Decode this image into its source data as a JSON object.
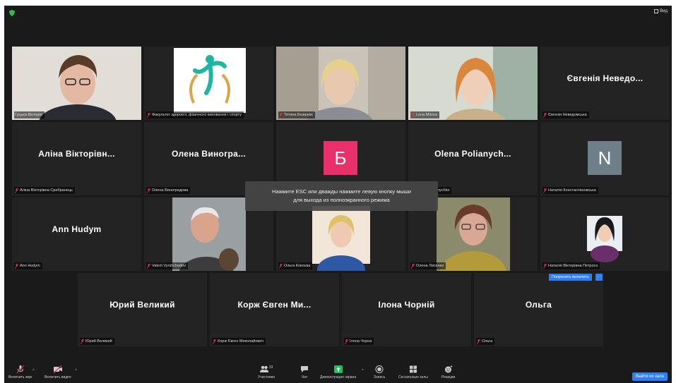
{
  "window": {
    "view_label": "Вид"
  },
  "grid": {
    "row1": [
      {
        "name": "Гуцька Вікторія",
        "display": "video"
      },
      {
        "name": "Факультет здоров'я, фізичного виховання і спорту",
        "display": "logo"
      },
      {
        "name": "Тетяна Бозанюк",
        "display": "video"
      },
      {
        "name": "Lena Mitova",
        "display": "video"
      },
      {
        "name": "Євгенія Неведомська",
        "display": "name",
        "big": "Євгенія Неведо..."
      }
    ],
    "row2": [
      {
        "name": "Аліна Вікторівна Сребранець",
        "display": "name",
        "big": "Аліна Вікторівн..."
      },
      {
        "name": "Олена Виноградова",
        "display": "name",
        "big": "Олена Виногра..."
      },
      {
        "name": "",
        "display": "letter",
        "letter": "Б",
        "letter_color": "#e8306a"
      },
      {
        "name": "nychko",
        "display": "name",
        "big": "Olena Polianych..."
      },
      {
        "name": "Наталія Константиновська",
        "display": "letter",
        "letter": "N",
        "letter_color": "#6f7f8a"
      }
    ],
    "row3": [
      {
        "name": "Ann Hudym",
        "display": "name",
        "big": "Ann Hudym"
      },
      {
        "name": "Valerii Vyrshchedov",
        "display": "video"
      },
      {
        "name": "Ольга Кокоєва",
        "display": "video"
      },
      {
        "name": "Олена Лисенко",
        "display": "video"
      },
      {
        "name": "Наталія Вікторівна Петросо",
        "display": "video"
      }
    ],
    "row4": [
      {
        "name": "Юрий Великий",
        "display": "name",
        "big": "Юрий Великий"
      },
      {
        "name": "Корж Євген Миколайович",
        "display": "name",
        "big": "Корж Євген Ми..."
      },
      {
        "name": "Ілона Чорна",
        "display": "name",
        "big": "Ілона Чорній"
      },
      {
        "name": "Ольга",
        "display": "name",
        "big": "Ольга"
      }
    ]
  },
  "toast": {
    "line1": "Нажмите ESC или дважды нажмите левую кнопку мыши",
    "line2": "для выхода из полноэкранного режима"
  },
  "ask_unmute": {
    "label": "Попросить включить",
    "more": "···"
  },
  "toolbar": {
    "audio": "Включить звук",
    "video": "Включить видео",
    "participants": "Участники",
    "participants_count": "19",
    "chat": "Чат",
    "share": "Демонстрация экрана",
    "record": "Запись",
    "rooms": "Сессионные залы",
    "reactions": "Реакции",
    "leave": "Выйти из зала"
  },
  "colors": {
    "accent": "#2d7ff9",
    "active_border": "#cfe86a",
    "share_green": "#22c05a",
    "mute_red": "#e0323c"
  }
}
